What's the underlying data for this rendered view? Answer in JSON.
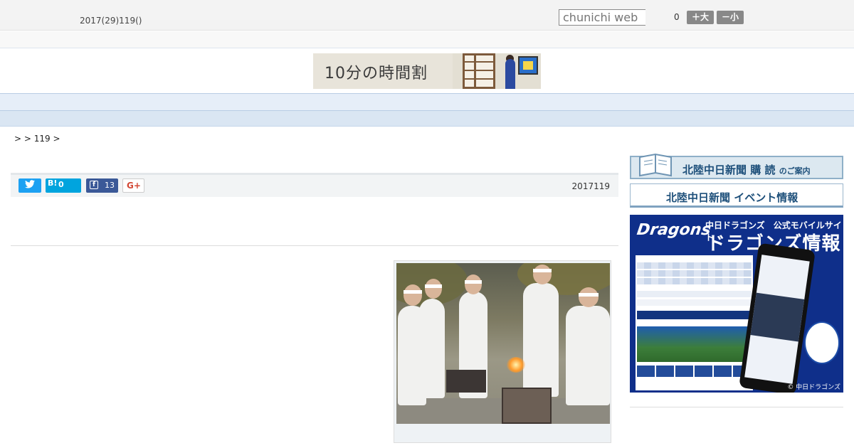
{
  "header": {
    "date": "2017(29)119()",
    "search_placeholder": "chunichi web",
    "font_count": "0",
    "font_bigger": "＋大",
    "font_smaller": "－小"
  },
  "banner": {
    "text": "10分の時間割"
  },
  "nav": {
    "items": [
      "",
      "",
      "",
      "",
      "",
      "",
      "",
      "",
      ""
    ]
  },
  "breadcrumb": ">  > 119 >",
  "share": {
    "twitter_icon": "twitter-icon",
    "hatena_label": "B!",
    "hatena_count": "0",
    "facebook_label": "f",
    "facebook_count": "13",
    "gplus_label": "G+",
    "date": "2017119"
  },
  "sidebar": {
    "subscribe_main": "北陸中日新聞 購 読",
    "subscribe_small": "のご案内",
    "events": "北陸中日新聞 イベント情報",
    "ad": {
      "logo": "Dragons",
      "sub": "中日ドラゴンズ　公式モバイルサイト",
      "title": "ドラゴンズ情報",
      "copyright": "© 中日ドラゴンズ"
    }
  },
  "colors": {
    "nav_bg": "#e6eef8",
    "twitter": "#1da1f2",
    "hatena": "#00a4de",
    "facebook": "#3b5998",
    "dragons_blue": "#0f2f8a"
  }
}
